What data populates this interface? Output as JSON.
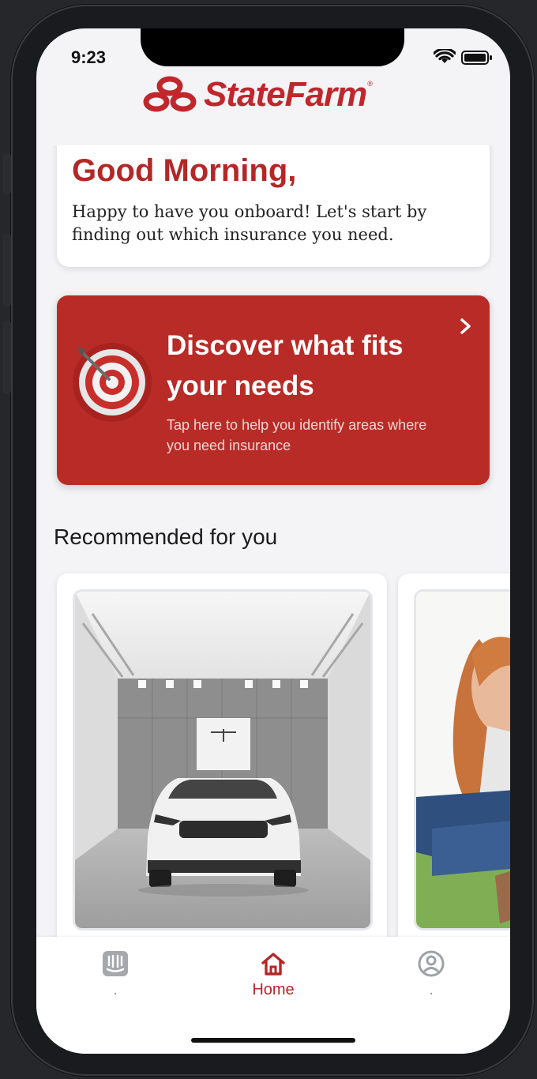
{
  "status_bar": {
    "time": "9:23"
  },
  "brand": {
    "name": "StateFarm",
    "reg_mark": "®",
    "color": "#c0272d"
  },
  "greeting": {
    "title": "Good Morning,",
    "subtitle": "Happy to have you onboard! Let's start by finding out which insurance you need."
  },
  "discover": {
    "title": "Discover what fits your needs",
    "subtitle": "Tap here to help you identify areas where you need insurance",
    "icon": "target-icon",
    "background": "#b82b27"
  },
  "recommended": {
    "section_title": "Recommended for you",
    "cards": [
      {
        "image": "car-showroom-photo"
      },
      {
        "image": "woman-outdoors-photo"
      }
    ]
  },
  "tabbar": {
    "tabs": [
      {
        "label": ".",
        "icon": "inbox-icon",
        "active": false
      },
      {
        "label": "Home",
        "icon": "home-icon",
        "active": true
      },
      {
        "label": ".",
        "icon": "profile-icon",
        "active": false
      }
    ],
    "active_color": "#b42727"
  }
}
